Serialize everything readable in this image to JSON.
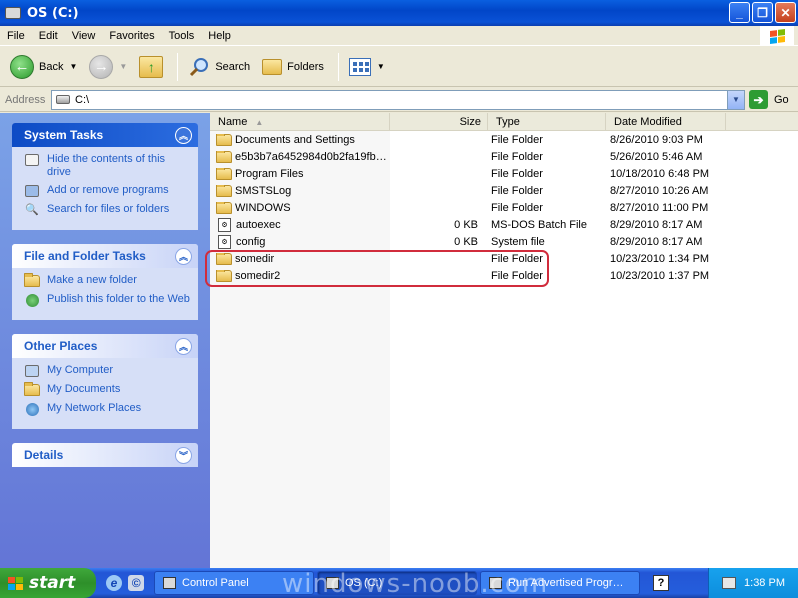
{
  "window": {
    "title": "OS (C:)",
    "minimize": "_",
    "maximize": "❐",
    "close": "✕"
  },
  "menu": [
    "File",
    "Edit",
    "View",
    "Favorites",
    "Tools",
    "Help"
  ],
  "toolbar": {
    "back_label": "Back",
    "search_label": "Search",
    "folders_label": "Folders"
  },
  "address": {
    "label": "Address",
    "value": "C:\\",
    "go_label": "Go"
  },
  "left_pane": {
    "system_tasks": {
      "title": "System Tasks",
      "items": [
        "Hide the contents of this drive",
        "Add or remove programs",
        "Search for files or folders"
      ]
    },
    "file_folder_tasks": {
      "title": "File and Folder Tasks",
      "items": [
        "Make a new folder",
        "Publish this folder to the Web"
      ]
    },
    "other_places": {
      "title": "Other Places",
      "items": [
        "My Computer",
        "My Documents",
        "My Network Places"
      ]
    },
    "details": {
      "title": "Details"
    }
  },
  "columns": {
    "name": "Name",
    "size": "Size",
    "type": "Type",
    "date": "Date Modified"
  },
  "files": [
    {
      "name": "Documents and Settings",
      "size": "",
      "type": "File Folder",
      "date": "8/26/2010 9:03 PM",
      "icon": "folder"
    },
    {
      "name": "e5b3b7a6452984d0b2fa19fb…",
      "size": "",
      "type": "File Folder",
      "date": "5/26/2010 5:46 AM",
      "icon": "folder"
    },
    {
      "name": "Program Files",
      "size": "",
      "type": "File Folder",
      "date": "10/18/2010 6:48 PM",
      "icon": "folder"
    },
    {
      "name": "SMSTSLog",
      "size": "",
      "type": "File Folder",
      "date": "8/27/2010 10:26 AM",
      "icon": "folder"
    },
    {
      "name": "WINDOWS",
      "size": "",
      "type": "File Folder",
      "date": "8/27/2010 11:00 PM",
      "icon": "folder"
    },
    {
      "name": "autoexec",
      "size": "0 KB",
      "type": "MS-DOS Batch File",
      "date": "8/29/2010 8:17 AM",
      "icon": "batch"
    },
    {
      "name": "config",
      "size": "0 KB",
      "type": "System file",
      "date": "8/29/2010 8:17 AM",
      "icon": "system"
    },
    {
      "name": "somedir",
      "size": "",
      "type": "File Folder",
      "date": "10/23/2010 1:34 PM",
      "icon": "folder"
    },
    {
      "name": "somedir2",
      "size": "",
      "type": "File Folder",
      "date": "10/23/2010 1:37 PM",
      "icon": "folder"
    }
  ],
  "taskbar": {
    "start_label": "start",
    "tasks": [
      "Control Panel",
      "OS (C:)",
      "Run Advertised Progr…"
    ],
    "clock": "1:38 PM",
    "help_glyph": "?",
    "watermark": "windows-noob.com"
  },
  "colors": {
    "xp_blue": "#0a52d6",
    "task_link": "#215dc6",
    "highlight_red": "#d12c3c",
    "start_green": "#37a533"
  }
}
